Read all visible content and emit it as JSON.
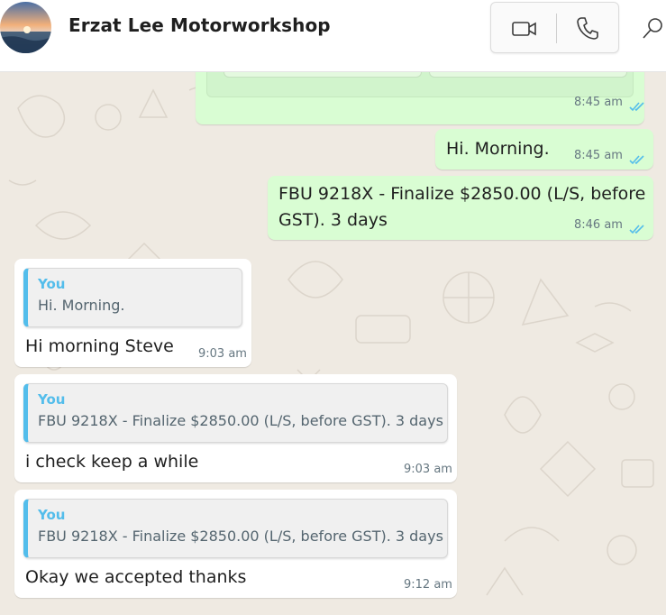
{
  "header": {
    "contact_name": "Erzat Lee Motorworkshop",
    "icons": {
      "video": "video-call-icon",
      "voice": "voice-call-icon",
      "search": "search-icon"
    }
  },
  "colors": {
    "outgoing_bubble": "#d9fdd3",
    "incoming_bubble": "#ffffff",
    "read_ticks": "#53bdeb",
    "quote_bar": "#53bdeb",
    "chat_background": "#efeae2"
  },
  "messages": [
    {
      "direction": "out",
      "text": "",
      "time": "8:45 am",
      "status": "read"
    },
    {
      "direction": "out",
      "text": "Hi. Morning.",
      "time": "8:45 am",
      "status": "read"
    },
    {
      "direction": "out",
      "text_line1": "FBU 9218X - Finalize $2850.00 (L/S, before",
      "text_line2": "GST). 3 days",
      "time": "8:46 am",
      "status": "read"
    },
    {
      "direction": "in",
      "quote": {
        "author": "You",
        "text": "Hi. Morning."
      },
      "text": "Hi morning Steve",
      "time": "9:03 am"
    },
    {
      "direction": "in",
      "quote": {
        "author": "You",
        "text": "FBU 9218X - Finalize $2850.00 (L/S, before GST). 3 days"
      },
      "text": "i check keep a while",
      "time": "9:03 am"
    },
    {
      "direction": "in",
      "quote": {
        "author": "You",
        "text": "FBU 9218X - Finalize $2850.00 (L/S, before GST). 3 days"
      },
      "text": "Okay we accepted thanks",
      "time": "9:12 am"
    }
  ]
}
